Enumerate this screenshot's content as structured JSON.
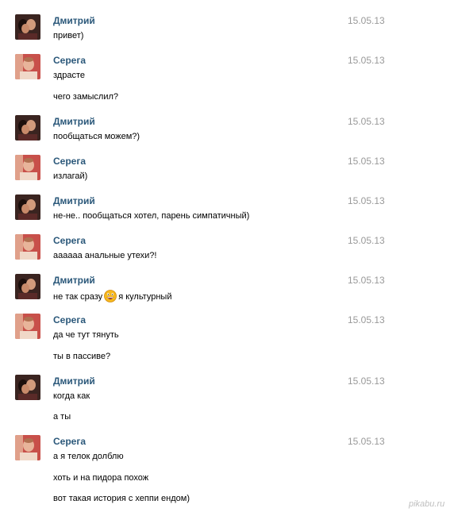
{
  "messages": [
    {
      "author": "Дмитрий",
      "date": "15.05.13",
      "avatar": "avatar-dmitry",
      "lines": [
        "привет)"
      ]
    },
    {
      "author": "Серега",
      "date": "15.05.13",
      "avatar": "avatar-serega",
      "lines": [
        "здрасте",
        "чего замыслил?"
      ]
    },
    {
      "author": "Дмитрий",
      "date": "15.05.13",
      "avatar": "avatar-dmitry",
      "lines": [
        "пообщаться можем?)"
      ]
    },
    {
      "author": "Серега",
      "date": "15.05.13",
      "avatar": "avatar-serega",
      "lines": [
        "излагай)"
      ]
    },
    {
      "author": "Дмитрий",
      "date": "15.05.13",
      "avatar": "avatar-dmitry",
      "lines": [
        "не-не.. пообщаться хотел, парень симпатичный)"
      ]
    },
    {
      "author": "Серега",
      "date": "15.05.13",
      "avatar": "avatar-serega",
      "lines": [
        "аааааа анальные утехи?!"
      ]
    },
    {
      "author": "Дмитрий",
      "date": "15.05.13",
      "avatar": "avatar-dmitry",
      "lines_before_emoji": "не так сразу",
      "emoji": "grinning-face-emoji",
      "lines_after_emoji": "я культурный"
    },
    {
      "author": "Серега",
      "date": "15.05.13",
      "avatar": "avatar-serega",
      "lines": [
        "да че тут тянуть",
        "ты в пассиве?"
      ]
    },
    {
      "author": "Дмитрий",
      "date": "15.05.13",
      "avatar": "avatar-dmitry",
      "lines": [
        "когда как",
        "а ты"
      ]
    },
    {
      "author": "Серега",
      "date": "15.05.13",
      "avatar": "avatar-serega",
      "lines": [
        "а я телок долблю",
        "хоть и на пидора похож",
        "вот такая история с хеппи ендом)"
      ]
    }
  ],
  "watermark": "pikabu.ru",
  "colors": {
    "author_name": "#2b587a",
    "date": "#999999",
    "message_text": "#000000",
    "background": "#ffffff"
  }
}
